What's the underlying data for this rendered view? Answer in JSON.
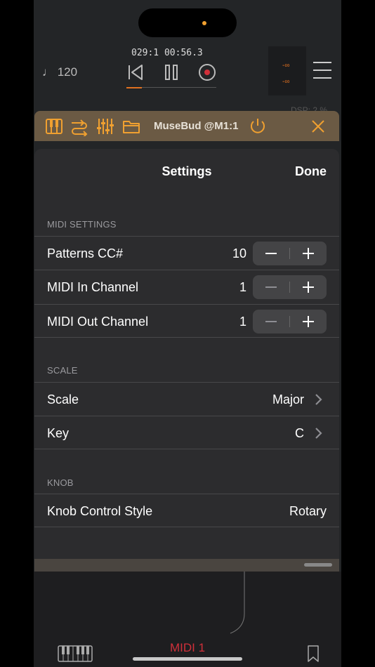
{
  "transport": {
    "tempo": "♩ 120",
    "timecode": "029:1  00:56.3",
    "meter_top": "-∞",
    "meter_bottom": "-∞"
  },
  "dsp": "DSP: 2 %",
  "plugin": {
    "title": "MuseBud @M1:1"
  },
  "settings": {
    "title": "Settings",
    "done_label": "Done",
    "midi_section": "MIDI SETTINGS",
    "patterns_label": "Patterns CC#",
    "patterns_value": "10",
    "midi_in_label": "MIDI In Channel",
    "midi_in_value": "1",
    "midi_out_label": "MIDI Out Channel",
    "midi_out_value": "1",
    "scale_section": "SCALE",
    "scale_label": "Scale",
    "scale_value": "Major",
    "key_label": "Key",
    "key_value": "C",
    "knob_section": "KNOB",
    "knob_label": "Knob Control Style",
    "knob_value": "Rotary"
  },
  "bottom": {
    "track_label": "MIDI 1"
  },
  "colors": {
    "accent": "#e07020",
    "midi_label": "#d0303a",
    "sheet_bg": "#2c2c2e"
  }
}
